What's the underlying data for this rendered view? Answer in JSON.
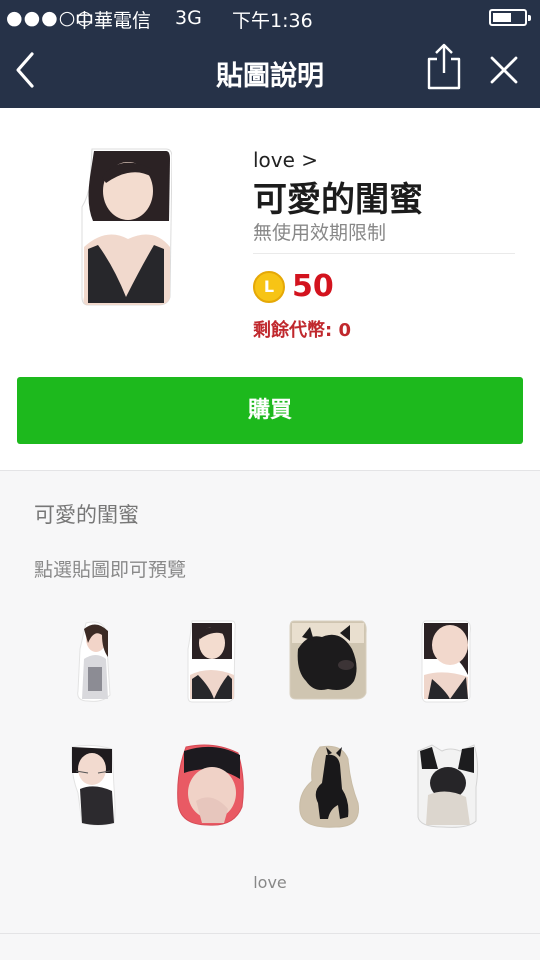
{
  "status_bar": {
    "signal": "●●●○○",
    "carrier": "中華電信",
    "network": "3G",
    "time": "下午1:36"
  },
  "nav": {
    "title": "貼圖說明",
    "back_icon": "chevron-left-icon",
    "share_icon": "share-icon",
    "close_icon": "close-icon"
  },
  "product": {
    "author": "love >",
    "name": "可愛的閨蜜",
    "validity": "無使用效期限制",
    "coin_symbol": "L",
    "price": "50",
    "balance": "剩餘代幣: 0",
    "buy_label": "購買"
  },
  "preview": {
    "title": "可愛的閨蜜",
    "hint": "點選貼圖即可預覽",
    "copyright": "love",
    "stickers": [
      "girl-standing-sticker",
      "girl-portrait-sticker",
      "black-dog-sticker",
      "girl-closeup-sticker",
      "girl-cat-whiskers-sticker",
      "girl-hand-face-sticker",
      "black-dog-sitting-sticker",
      "dog-with-ears-sticker"
    ]
  },
  "colors": {
    "header_bg": "#263248",
    "buy_green": "#1db91d",
    "price_red": "#d3131e",
    "coin_yellow": "#f7c415"
  }
}
